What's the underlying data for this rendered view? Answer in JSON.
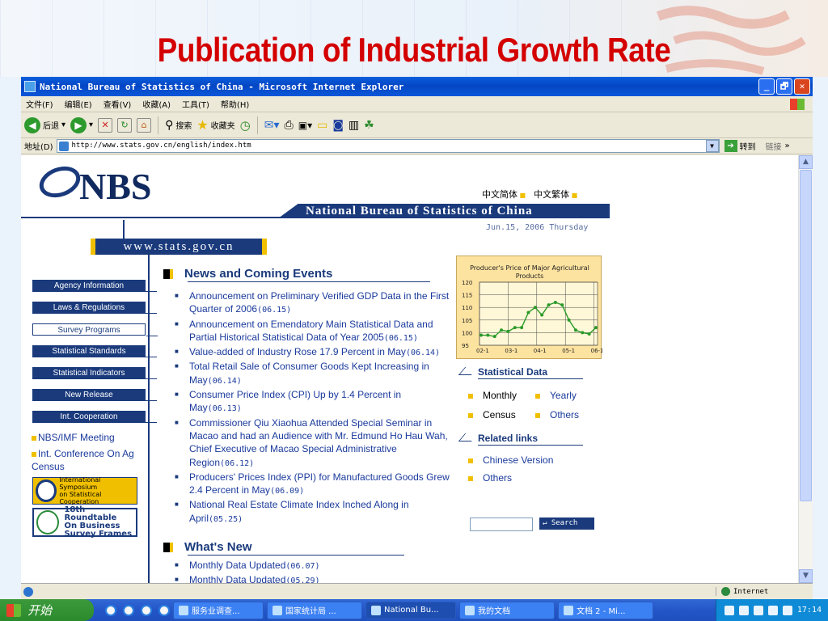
{
  "slide": {
    "title": "Publication of Industrial Growth Rate"
  },
  "window": {
    "title": "National Bureau of Statistics of China - Microsoft Internet Explorer",
    "buttons": [
      "_",
      "🗗",
      "✕"
    ]
  },
  "menu": [
    "文件(F)",
    "编辑(E)",
    "查看(V)",
    "收藏(A)",
    "工具(T)",
    "帮助(H)"
  ],
  "toolbar": {
    "back": "后退",
    "search": "搜索",
    "favorites": "收藏夹"
  },
  "address": {
    "label": "地址(D)",
    "url": "http://www.stats.gov.cn/english/index.htm",
    "go": "转到",
    "links": "链接"
  },
  "site": {
    "logo": "NBS",
    "lang1": "中文简体",
    "lang2": "中文繁体",
    "banner": "National Bureau of Statistics of China",
    "date": "Jun.15, 2006 Thursday",
    "url": "www.stats.gov.cn",
    "nav": [
      "Agency Information",
      "Laws & Regulations",
      "Survey Programs",
      "Statistical Standards",
      "Statistical Indicators",
      "New Release",
      "Int. Cooperation"
    ],
    "side_links": [
      "NBS/IMF Meeting",
      "Int. Conference On Ag Census"
    ],
    "badge1": [
      "International Symposium",
      "on Statistical Cooperation"
    ],
    "badge2": [
      "18th Roundtable",
      "On Business",
      "Survey Frames"
    ],
    "news_title": "News and Coming Events",
    "news": [
      {
        "t": "Announcement on Preliminary Verified GDP Data in the First Quarter of 2006",
        "d": "(06.15)"
      },
      {
        "t": "Announcement on Emendatory Main Statistical Data and Partial Historical Statistical Data of Year 2005",
        "d": "(06.15)"
      },
      {
        "t": "Value-added of Industry Rose 17.9 Percent in May",
        "d": "(06.14)"
      },
      {
        "t": "Total Retail Sale of Consumer Goods Kept Increasing in May",
        "d": "(06.14)"
      },
      {
        "t": "Consumer Price Index (CPI) Up by 1.4 Percent in May",
        "d": "(06.13)"
      },
      {
        "t": "Commissioner Qiu Xiaohua Attended Special Seminar in Macao and had an Audience with Mr. Edmund Ho Hau Wah, Chief Executive of Macao Special Administrative Region",
        "d": "(06.12)"
      },
      {
        "t": "Producers' Prices Index (PPI) for Manufactured Goods Grew 2.4 Percent in May",
        "d": "(06.09)"
      },
      {
        "t": "National Real Estate Climate Index Inched Along in April",
        "d": "(05.25)"
      }
    ],
    "whats_new_title": "What's New",
    "whats_new": [
      {
        "t": "Monthly Data Updated",
        "d": "(06.07)"
      },
      {
        "t": "Monthly Data Updated",
        "d": "(05.29)"
      }
    ],
    "stat_title": "Statistical Data",
    "stat_items": [
      "Monthly",
      "Yearly",
      "Census",
      "Others"
    ],
    "related_title": "Related links",
    "related": [
      "Chinese Version",
      "Others"
    ],
    "search_btn": "Search"
  },
  "chart_data": {
    "type": "line",
    "title": "Producer's Price of Major Agricultural Products",
    "x_ticks": [
      "02-1",
      "03-1",
      "04-1",
      "05-1",
      "06-1"
    ],
    "y_ticks": [
      95,
      100,
      105,
      110,
      115,
      120
    ],
    "ylim": [
      95,
      120
    ],
    "grid": true,
    "values": [
      99,
      99,
      98.5,
      101,
      100.5,
      102,
      102,
      108,
      110,
      107,
      111,
      112,
      111,
      105,
      101,
      100,
      99.5,
      102
    ],
    "line_color": "#2a9a2a"
  },
  "status": {
    "zone": "Internet"
  },
  "taskbar": {
    "start": "开始",
    "tasks": [
      "服务业调查...",
      "国家统计局 ...",
      "National Bu...",
      "我的文档",
      "文档 2 - Mi..."
    ],
    "clock": "17:14"
  }
}
